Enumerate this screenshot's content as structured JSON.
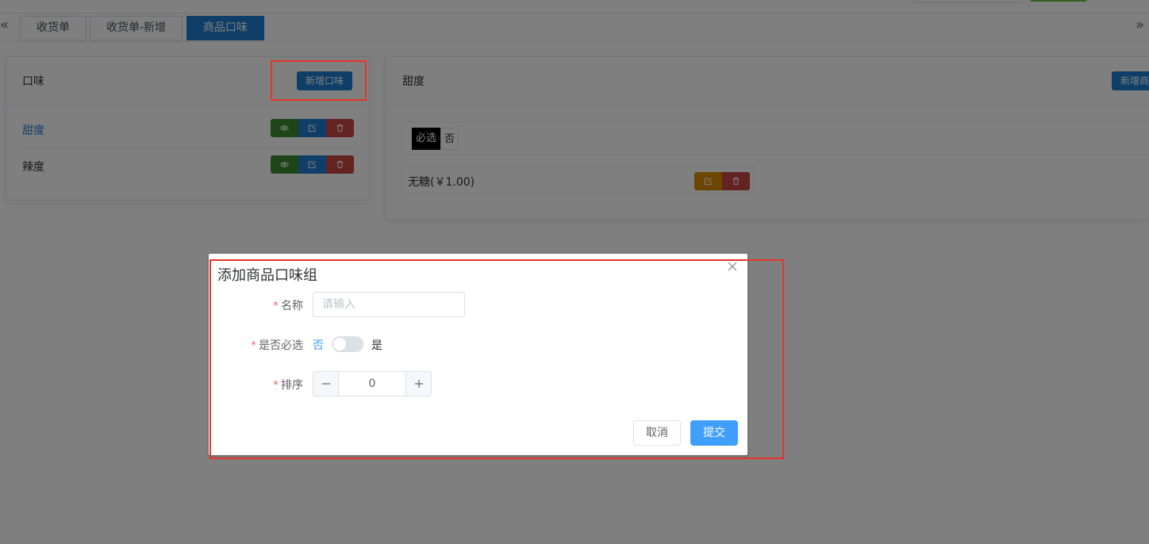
{
  "tabs": {
    "left_arrow": "«",
    "right_arrow": "»",
    "items": [
      {
        "label": "收货单"
      },
      {
        "label": "收货单-新增"
      },
      {
        "label": "商品口味"
      }
    ]
  },
  "left_card": {
    "title": "口味",
    "add_label": "新增口味",
    "rows": [
      {
        "name": "甜度"
      },
      {
        "name": "辣度"
      }
    ]
  },
  "right_card": {
    "title": "甜度",
    "add_label": "新增商",
    "required_tag": "必选",
    "required_value": "否",
    "option_text": "无糖(￥1.00)"
  },
  "dialog": {
    "title": "添加商品口味组",
    "name_label": "名称",
    "name_placeholder": "请输入",
    "required_label": "是否必选",
    "switch_off": "否",
    "switch_on": "是",
    "sort_label": "排序",
    "sort_value": "0",
    "cancel_label": "取消",
    "submit_label": "提交"
  },
  "colors": {
    "primary": "#1f7ed0",
    "accent": "#409eff",
    "annotation": "#e8332b"
  }
}
